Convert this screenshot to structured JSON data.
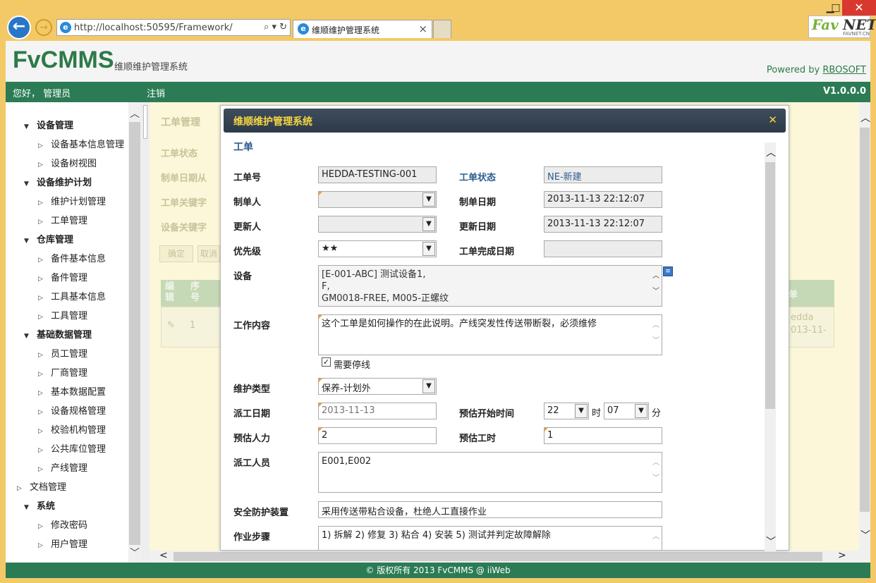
{
  "browser": {
    "url": "http://localhost:50595/Framework/",
    "tab_title": "维顺维护管理系统",
    "logo_fav": "Fav",
    "logo_net": "NET",
    "logo_sub": "FAVNET.CN"
  },
  "header": {
    "app_name": "FvCMMS",
    "subtitle": "维顺维护管理系统",
    "powered_label": "Powered by",
    "powered_link": "RBOSOFT",
    "greeting": "您好， 管理员",
    "logout": "注销",
    "version": "V1.0.0.0"
  },
  "sidebar": {
    "items": [
      {
        "label": "设备管理",
        "group": true
      },
      {
        "label": "设备基本信息管理",
        "group": false
      },
      {
        "label": "设备树视图",
        "group": false
      },
      {
        "label": "设备维护计划",
        "group": true
      },
      {
        "label": "维护计划管理",
        "group": false
      },
      {
        "label": "工单管理",
        "group": false
      },
      {
        "label": "仓库管理",
        "group": true
      },
      {
        "label": "备件基本信息",
        "group": false
      },
      {
        "label": "备件管理",
        "group": false
      },
      {
        "label": "工具基本信息",
        "group": false
      },
      {
        "label": "工具管理",
        "group": false
      },
      {
        "label": "基础数据管理",
        "group": true
      },
      {
        "label": "员工管理",
        "group": false
      },
      {
        "label": "厂商管理",
        "group": false
      },
      {
        "label": "基本数据配置",
        "group": false
      },
      {
        "label": "设备规格管理",
        "group": false
      },
      {
        "label": "校验机构管理",
        "group": false
      },
      {
        "label": "公共库位管理",
        "group": false
      },
      {
        "label": "产线管理",
        "group": false
      },
      {
        "label": "文档管理",
        "group": "collapsed"
      },
      {
        "label": "系统",
        "group": true
      },
      {
        "label": "修改密码",
        "group": false
      },
      {
        "label": "用户管理",
        "group": false
      }
    ]
  },
  "background": {
    "title": "工单管理",
    "filters": [
      "工单状态",
      "制单日期从",
      "工单关键字",
      "设备关键字"
    ],
    "confirm": "确定",
    "cancel": "取消",
    "col_edit": "编辑",
    "col_no": "序号",
    "col_right": "单",
    "row_no": "1",
    "row_right": "edda\n013-11-"
  },
  "modal": {
    "title": "维顺维护管理系统",
    "section": "工单",
    "labels": {
      "wo_no": "工单号",
      "wo_status": "工单状态",
      "creator": "制单人",
      "create_date": "制单日期",
      "updater": "更新人",
      "update_date": "更新日期",
      "priority": "优先级",
      "finish_date": "工单完成日期",
      "device": "设备",
      "content": "工作内容",
      "need_stop": "需要停线",
      "maint_type": "维护类型",
      "dispatch_date": "派工日期",
      "est_start": "预估开始时间",
      "est_manpower": "预估人力",
      "est_hours": "预估工时",
      "dispatch_staff": "派工人员",
      "safety": "安全防护装置",
      "steps": "作业步骤",
      "hour_unit": "时",
      "minute_unit": "分"
    },
    "values": {
      "wo_no": "HEDDA-TESTING-001",
      "wo_status": "NE-新建",
      "creator": "",
      "create_date": "2013-11-13 22:12:07",
      "updater": "",
      "update_date": "2013-11-13 22:12:07",
      "priority": "★★",
      "finish_date": "",
      "device_lines": [
        "[E-001-ABC] 测试设备1,",
        "F,",
        "GM0018-FREE, M005-正螺纹"
      ],
      "content": "这个工单是如何操作的在此说明。产线突发性传送带断裂，必须维修",
      "need_stop": true,
      "maint_type": "保养-计划外",
      "dispatch_date": "2013-11-13",
      "est_hour": "22",
      "est_minute": "07",
      "est_manpower": "2",
      "est_hours": "1",
      "dispatch_staff": "E001,E002",
      "safety": "采用传送带粘合设备，杜绝人工直接作业",
      "steps": "1) 拆解 2) 修复 3) 粘合 4) 安装 5) 测试并判定故障解除"
    }
  },
  "footer": "© 版权所有 2013 FvCMMS @ iiWeb"
}
